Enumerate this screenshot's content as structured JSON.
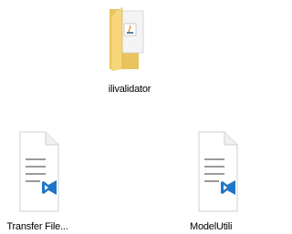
{
  "files": [
    {
      "name": "ilivalidator",
      "icon": "folder-with-java-file-icon",
      "kind": "folder"
    },
    {
      "name": "Transfer File...",
      "icon": "vscode-document-icon",
      "kind": "file"
    },
    {
      "name": "ModelUtili",
      "icon": "vscode-document-icon",
      "kind": "file"
    }
  ]
}
